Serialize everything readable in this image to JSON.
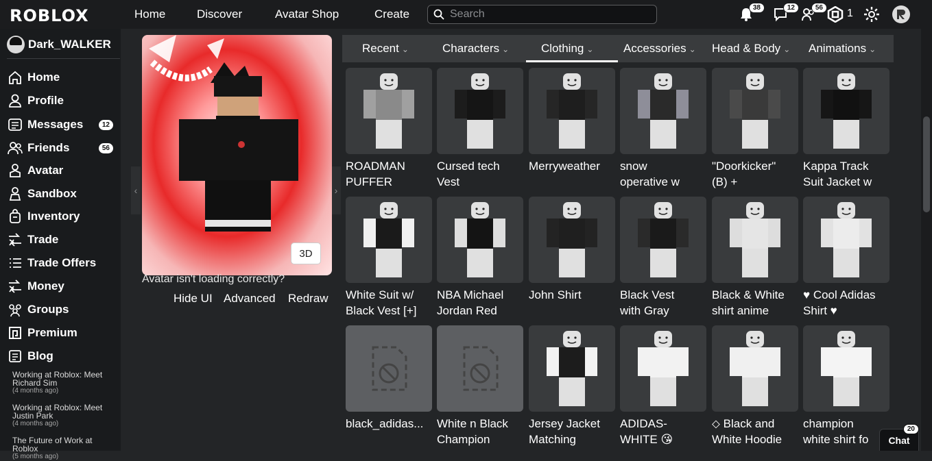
{
  "topbar": {
    "logo": "ROBLOX",
    "nav": [
      "Home",
      "Discover",
      "Avatar Shop",
      "Create"
    ],
    "search_placeholder": "Search",
    "notifications_badge": "38",
    "messages_badge": "12",
    "friends_badge": "56",
    "robux_count": "1"
  },
  "sidebar": {
    "username": "Dark_WALKER",
    "items": [
      {
        "label": "Home",
        "icon": "home-icon"
      },
      {
        "label": "Profile",
        "icon": "profile-icon"
      },
      {
        "label": "Messages",
        "icon": "messages-icon",
        "badge": "12"
      },
      {
        "label": "Friends",
        "icon": "friends-icon",
        "badge": "56"
      },
      {
        "label": "Avatar",
        "icon": "avatar-icon"
      },
      {
        "label": "Sandbox",
        "icon": "sandbox-icon"
      },
      {
        "label": "Inventory",
        "icon": "inventory-icon"
      },
      {
        "label": "Trade",
        "icon": "trade-icon"
      },
      {
        "label": "Trade Offers",
        "icon": "trade-offers-icon"
      },
      {
        "label": "Money",
        "icon": "money-icon"
      },
      {
        "label": "Groups",
        "icon": "groups-icon"
      },
      {
        "label": "Premium",
        "icon": "premium-icon"
      },
      {
        "label": "Blog",
        "icon": "blog-icon"
      }
    ],
    "blog": [
      {
        "title": "Working at Roblox: Meet Richard Sim",
        "date": "(4 months ago)"
      },
      {
        "title": "Working at Roblox: Meet Justin Park",
        "date": "(4 months ago)"
      },
      {
        "title": "The Future of Work at Roblox",
        "date": "(5 months ago)"
      }
    ]
  },
  "preview": {
    "btn_3d": "3D",
    "message": "Avatar isn't loading correctly?",
    "actions": [
      "Hide UI",
      "Advanced",
      "Redraw"
    ]
  },
  "tabs": [
    "Recent",
    "Characters",
    "Clothing",
    "Accessories",
    "Head & Body",
    "Animations"
  ],
  "items": [
    {
      "name": "ROADMAN\nPUFFER",
      "torso": "#8a8a8a",
      "arms": "#a0a0a0",
      "legs": "#e0e0e0"
    },
    {
      "name": "Cursed tech\nVest",
      "torso": "#151515",
      "arms": "#1c1c1c",
      "legs": "#e0e0e0"
    },
    {
      "name": "Merryweather",
      "torso": "#1e1e1e",
      "arms": "#262626",
      "legs": "#e0e0e0"
    },
    {
      "name": "snow\noperative w",
      "torso": "#2a2a2a",
      "arms": "#8e8e99",
      "legs": "#e0e0e0"
    },
    {
      "name": "\"Doorkicker\"\n(B) +",
      "torso": "#3a3a3a",
      "arms": "#4a4a4a",
      "legs": "#e0e0e0"
    },
    {
      "name": "Kappa Track\nSuit Jacket w",
      "torso": "#111111",
      "arms": "#161616",
      "legs": "#e0e0e0"
    },
    {
      "name": "White Suit w/\nBlack Vest [+]",
      "torso": "#1a1a1a",
      "arms": "#f0f0f0",
      "legs": "#e0e0e0"
    },
    {
      "name": "NBA Michael\nJordan Red",
      "torso": "#141414",
      "arms": "#dedede",
      "legs": "#e0e0e0"
    },
    {
      "name": "John Shirt",
      "torso": "#1f1f1f",
      "arms": "#232323",
      "legs": "#e0e0e0"
    },
    {
      "name": "Black Vest\nwith Gray",
      "torso": "#1a1a1a",
      "arms": "#2a2a2a",
      "legs": "#e0e0e0"
    },
    {
      "name": "Black & White\nshirt anime",
      "torso": "#e5e5e5",
      "arms": "#dddddd",
      "legs": "#e0e0e0"
    },
    {
      "name": "♥ Cool Adidas\nShirt ♥",
      "torso": "#ececec",
      "arms": "#e2e2e2",
      "legs": "#e0e0e0"
    },
    {
      "name": "black_adidas...",
      "broken": true
    },
    {
      "name": "White n Black\nChampion",
      "broken": true
    },
    {
      "name": "Jersey Jacket\nMatching",
      "torso": "#1c1c1c",
      "arms": "#f2f2f2",
      "legs": "#e0e0e0"
    },
    {
      "name": "ADIDAS-\nWHITE 😘",
      "torso": "#f2f2f2",
      "arms": "#f2f2f2",
      "legs": "#e0e0e0"
    },
    {
      "name": "⬦ Black and\nWhite Hoodie",
      "torso": "#f0f0f0",
      "arms": "#f0f0f0",
      "legs": "#e0e0e0"
    },
    {
      "name": "champion\nwhite shirt fo",
      "torso": "#f4f4f4",
      "arms": "#f4f4f4",
      "legs": "#e0e0e0"
    }
  ],
  "chat": {
    "label": "Chat",
    "badge": "20"
  }
}
